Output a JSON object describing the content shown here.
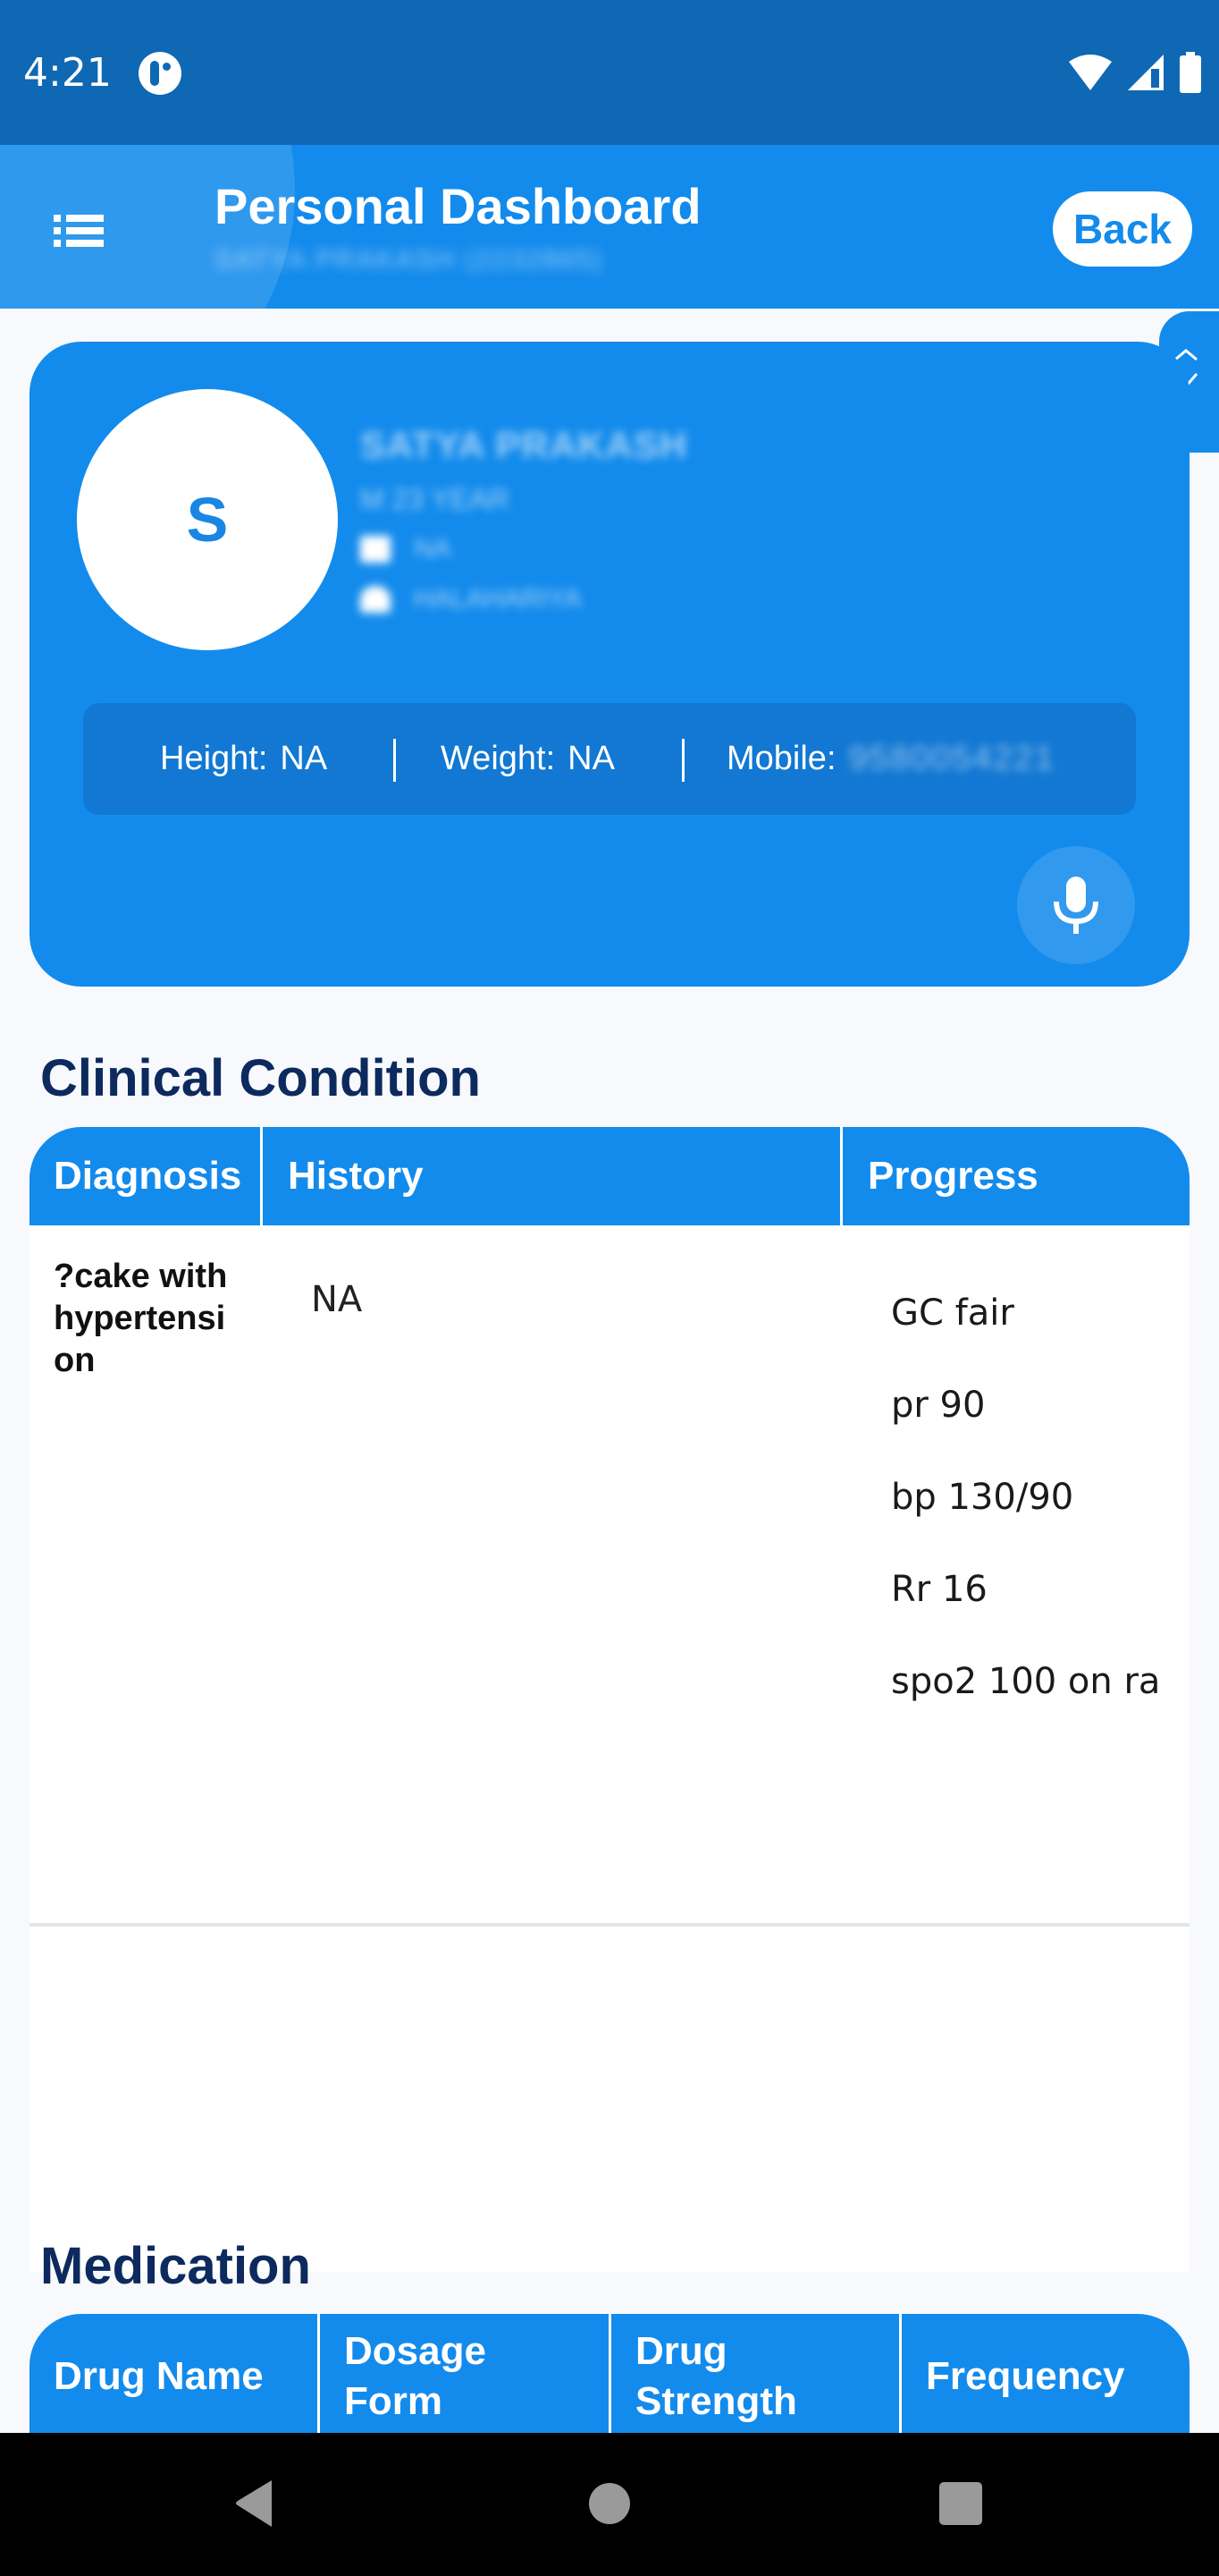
{
  "status_bar": {
    "time": "4:21",
    "app_icon": "notification-app-icon",
    "icons": [
      "wifi-icon",
      "cellular-signal-icon",
      "battery-icon"
    ]
  },
  "header": {
    "title": "Personal Dashboard",
    "subtitle": "SATYA PRAKASH (2232865)",
    "back_label": "Back",
    "menu_icon": "list-menu-icon"
  },
  "profile": {
    "avatar_initial": "S",
    "name": "SATYA PRAKASH",
    "gender_age": "M 23 YEAR",
    "contact_value": "NA",
    "address": "HALAHARIYA",
    "stats": {
      "height_label": "Height:",
      "height_value": "NA",
      "weight_label": "Weight:",
      "weight_value": "NA",
      "mobile_label": "Mobile:",
      "mobile_value": "9580054221"
    },
    "mic_icon": "microphone-icon"
  },
  "clinical_condition": {
    "title": "Clinical Condition",
    "columns": [
      "Diagnosis",
      "History",
      "Progress"
    ],
    "rows": [
      {
        "diagnosis": "?cake with hypertensi on",
        "history": "NA",
        "progress": [
          "GC fair",
          "pr 90",
          "bp 130/90",
          "Rr 16",
          "spo2 100 on ra"
        ]
      }
    ]
  },
  "medication": {
    "title": "Medication",
    "columns": [
      "Drug Name",
      "Dosage Form",
      "Drug Strength",
      "Frequency"
    ]
  },
  "colors": {
    "status_bar": "#0f68b4",
    "primary": "#138bec",
    "stats_bar": "#1278d3",
    "heading": "#0d2a5e",
    "background": "#f7f9fc"
  },
  "nav": {
    "back": "nav-back-icon",
    "home": "nav-home-icon",
    "recents": "nav-recents-icon"
  }
}
